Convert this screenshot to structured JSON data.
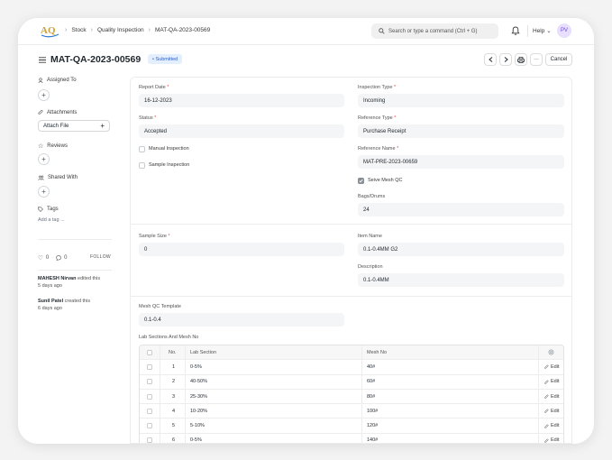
{
  "navbar": {
    "logo_text": "AQ",
    "breadcrumbs": [
      "Stock",
      "Quality Inspection",
      "MAT-QA-2023-00569"
    ],
    "search_placeholder": "Search or type a command (Ctrl + G)",
    "help_label": "Help",
    "avatar_initials": "PV"
  },
  "header": {
    "title": "MAT-QA-2023-00569",
    "status": "Submitted",
    "cancel_label": "Cancel",
    "more_label": "···"
  },
  "sidebar": {
    "assigned_to": "Assigned To",
    "attachments": "Attachments",
    "attach_file": "Attach File",
    "reviews": "Reviews",
    "shared_with": "Shared With",
    "tags": "Tags",
    "add_tag": "Add a tag ...",
    "likes": "0",
    "comments": "0",
    "follow": "FOLLOW",
    "timeline": [
      {
        "user": "MAHESH Nirvan",
        "action": " edited this",
        "when": "5 days ago"
      },
      {
        "user": "Sunil Patel",
        "action": " created this",
        "when": "6 days ago"
      }
    ]
  },
  "form": {
    "report_date": {
      "label": "Report Date",
      "value": "16-12-2023"
    },
    "inspection_type": {
      "label": "Inspection Type",
      "value": "Incoming"
    },
    "status": {
      "label": "Status",
      "value": "Accepted"
    },
    "reference_type": {
      "label": "Reference Type",
      "value": "Purchase Receipt"
    },
    "manual_inspection": {
      "label": "Manual Inspection",
      "checked": false
    },
    "sample_inspection": {
      "label": "Sample Inspection",
      "checked": false
    },
    "reference_name": {
      "label": "Reference Name",
      "value": "MAT-PRE-2023-00659"
    },
    "seive_mesh_qc": {
      "label": "Seive Mesh QC",
      "checked": true
    },
    "bags_drums": {
      "label": "Bags/Drums",
      "value": "24"
    },
    "sample_size": {
      "label": "Sample Size",
      "value": "0"
    },
    "item_name": {
      "label": "Item Name",
      "value": "0.1-0.4MM G2"
    },
    "description": {
      "label": "Description",
      "value": "0.1-0.4MM"
    },
    "mesh_qc_template": {
      "label": "Mesh QC Template",
      "value": "0.1-0.4"
    },
    "required_mark": "*"
  },
  "table": {
    "title": "Lab Sections And Mesh No",
    "headers": {
      "no": "No.",
      "lab_section": "Lab Section",
      "mesh_no": "Mesh No"
    },
    "edit_label": "Edit",
    "rows": [
      {
        "no": "1",
        "lab_section": "0-5%",
        "mesh_no": "40#"
      },
      {
        "no": "2",
        "lab_section": "40-50%",
        "mesh_no": "60#"
      },
      {
        "no": "3",
        "lab_section": "25-30%",
        "mesh_no": "80#"
      },
      {
        "no": "4",
        "lab_section": "10-20%",
        "mesh_no": "100#"
      },
      {
        "no": "5",
        "lab_section": "5-10%",
        "mesh_no": "120#"
      },
      {
        "no": "6",
        "lab_section": "0-5%",
        "mesh_no": "140#"
      }
    ]
  }
}
